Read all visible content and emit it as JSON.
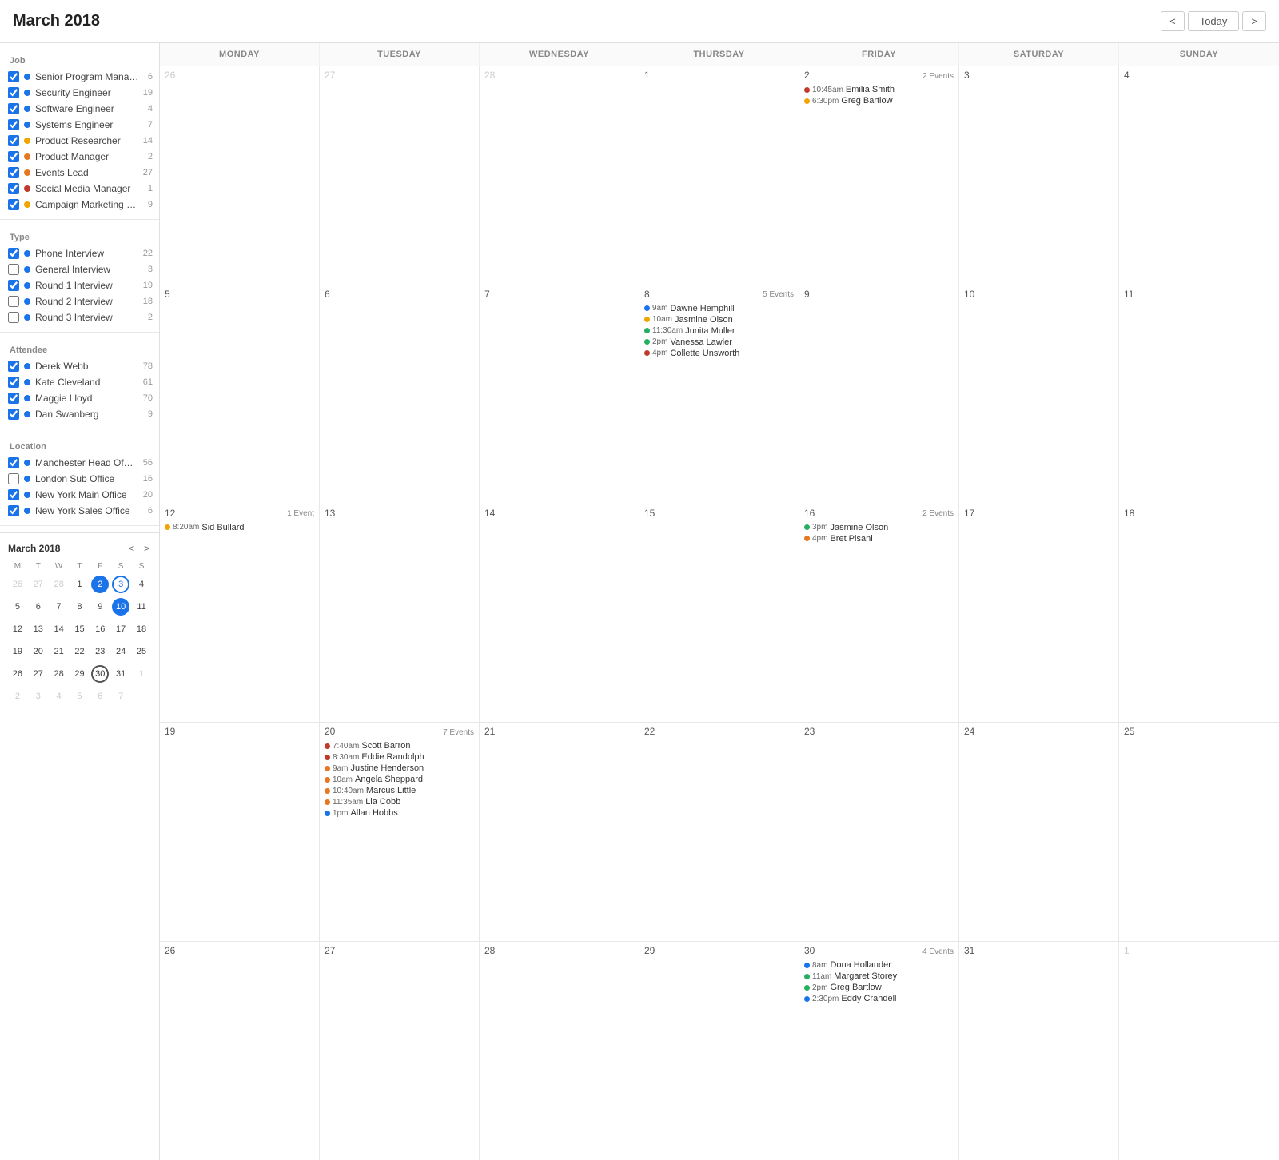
{
  "header": {
    "title": "March 2018",
    "nav_prev": "<",
    "nav_today": "Today",
    "nav_next": ">"
  },
  "sidebar": {
    "sections": [
      {
        "id": "job",
        "title": "Job",
        "items": [
          {
            "label": "Senior Program Manage...",
            "count": 6,
            "checked": true,
            "color": "#1a73e8"
          },
          {
            "label": "Security Engineer",
            "count": 19,
            "checked": true,
            "color": "#1a73e8"
          },
          {
            "label": "Software Engineer",
            "count": 4,
            "checked": true,
            "color": "#1a73e8"
          },
          {
            "label": "Systems Engineer",
            "count": 7,
            "checked": true,
            "color": "#1a73e8"
          },
          {
            "label": "Product Researcher",
            "count": 14,
            "checked": true,
            "color": "#f0a500"
          },
          {
            "label": "Product Manager",
            "count": 2,
            "checked": true,
            "color": "#e87722"
          },
          {
            "label": "Events Lead",
            "count": 27,
            "checked": true,
            "color": "#e87722"
          },
          {
            "label": "Social Media Manager",
            "count": 1,
            "checked": true,
            "color": "#c0392b"
          },
          {
            "label": "Campaign Marketing Ma...",
            "count": 9,
            "checked": true,
            "color": "#f0a500"
          }
        ]
      },
      {
        "id": "type",
        "title": "Type",
        "items": [
          {
            "label": "Phone Interview",
            "count": 22,
            "checked": true,
            "color": "#1a73e8"
          },
          {
            "label": "General Interview",
            "count": 3,
            "checked": false,
            "color": "#1a73e8"
          },
          {
            "label": "Round 1 Interview",
            "count": 19,
            "checked": true,
            "color": "#1a73e8"
          },
          {
            "label": "Round 2 Interview",
            "count": 18,
            "checked": false,
            "color": "#1a73e8"
          },
          {
            "label": "Round 3 Interview",
            "count": 2,
            "checked": false,
            "color": "#1a73e8"
          }
        ]
      },
      {
        "id": "attendee",
        "title": "Attendee",
        "items": [
          {
            "label": "Derek Webb",
            "count": 78,
            "checked": true,
            "color": "#1a73e8"
          },
          {
            "label": "Kate Cleveland",
            "count": 61,
            "checked": true,
            "color": "#1a73e8"
          },
          {
            "label": "Maggie Lloyd",
            "count": 70,
            "checked": true,
            "color": "#1a73e8"
          },
          {
            "label": "Dan Swanberg",
            "count": 9,
            "checked": true,
            "color": "#1a73e8"
          }
        ]
      },
      {
        "id": "location",
        "title": "Location",
        "items": [
          {
            "label": "Manchester Head Office",
            "count": 56,
            "checked": true,
            "color": "#1a73e8"
          },
          {
            "label": "London Sub Office",
            "count": 16,
            "checked": false,
            "color": "#1a73e8"
          },
          {
            "label": "New York Main Office",
            "count": 20,
            "checked": true,
            "color": "#1a73e8"
          },
          {
            "label": "New York Sales Office",
            "count": 6,
            "checked": true,
            "color": "#1a73e8"
          }
        ]
      }
    ]
  },
  "mini_calendar": {
    "title": "March 2018",
    "days_of_week": [
      "M",
      "T",
      "W",
      "T",
      "F",
      "S",
      "S"
    ],
    "weeks": [
      [
        {
          "day": 26,
          "other": true
        },
        {
          "day": 27,
          "other": true
        },
        {
          "day": 28,
          "other": true
        },
        {
          "day": 1
        },
        {
          "day": 2,
          "highlight": "blue"
        },
        {
          "day": 3,
          "highlight": "ring"
        },
        {
          "day": 4
        }
      ],
      [
        {
          "day": 5
        },
        {
          "day": 6
        },
        {
          "day": 7
        },
        {
          "day": 8
        },
        {
          "day": 9
        },
        {
          "day": 10,
          "highlight": "filled-blue"
        },
        {
          "day": 11
        }
      ],
      [
        {
          "day": 12
        },
        {
          "day": 13
        },
        {
          "day": 14
        },
        {
          "day": 15
        },
        {
          "day": 16
        },
        {
          "day": 17
        },
        {
          "day": 18
        }
      ],
      [
        {
          "day": 19
        },
        {
          "day": 20
        },
        {
          "day": 21
        },
        {
          "day": 22
        },
        {
          "day": 23
        },
        {
          "day": 24
        },
        {
          "day": 25
        }
      ],
      [
        {
          "day": 26
        },
        {
          "day": 27
        },
        {
          "day": 28
        },
        {
          "day": 29
        },
        {
          "day": 30,
          "highlight": "gray-ring"
        },
        {
          "day": 31
        },
        {
          "day": 1,
          "other": true
        }
      ],
      [
        {
          "day": 2,
          "other": true
        },
        {
          "day": 3,
          "other": true
        },
        {
          "day": 4,
          "other": true
        },
        {
          "day": 5,
          "other": true
        },
        {
          "day": 6,
          "other": true
        },
        {
          "day": 7,
          "other": true
        }
      ]
    ]
  },
  "calendar": {
    "col_headers": [
      "MONDAY",
      "TUESDAY",
      "WEDNESDAY",
      "THURSDAY",
      "FRIDAY",
      "SATURDAY",
      "SUNDAY"
    ],
    "weeks": [
      {
        "days": [
          {
            "num": 26,
            "other": true,
            "events": []
          },
          {
            "num": 27,
            "other": true,
            "events": []
          },
          {
            "num": 28,
            "other": true,
            "events": []
          },
          {
            "num": 1,
            "events": [],
            "events_count": ""
          },
          {
            "num": 2,
            "events_count": "2 Events",
            "events": [
              {
                "time": "10:45am",
                "name": "Emilia Smith",
                "color": "#c0392b"
              },
              {
                "time": "6:30pm",
                "name": "Greg Bartlow",
                "color": "#f0a500"
              }
            ]
          },
          {
            "num": 3,
            "events": []
          },
          {
            "num": 4,
            "events": []
          }
        ]
      },
      {
        "days": [
          {
            "num": 5,
            "events": []
          },
          {
            "num": 6,
            "events": []
          },
          {
            "num": 7,
            "events": []
          },
          {
            "num": 8,
            "events_count": "5 Events",
            "events": [
              {
                "time": "9am",
                "name": "Dawne Hemphill",
                "color": "#1a73e8"
              },
              {
                "time": "10am",
                "name": "Jasmine Olson",
                "color": "#f0a500"
              },
              {
                "time": "11:30am",
                "name": "Junita Muller",
                "color": "#27ae60"
              },
              {
                "time": "2pm",
                "name": "Vanessa Lawler",
                "color": "#27ae60"
              },
              {
                "time": "4pm",
                "name": "Collette Unsworth",
                "color": "#c0392b"
              }
            ]
          },
          {
            "num": 9,
            "events": []
          },
          {
            "num": 10,
            "events": []
          },
          {
            "num": 11,
            "events": []
          }
        ]
      },
      {
        "days": [
          {
            "num": 12,
            "events_count": "1 Event",
            "events": [
              {
                "time": "8:20am",
                "name": "Sid Bullard",
                "color": "#f0a500"
              }
            ]
          },
          {
            "num": 13,
            "events": []
          },
          {
            "num": 14,
            "events": []
          },
          {
            "num": 15,
            "events": []
          },
          {
            "num": 16,
            "events_count": "2 Events",
            "events": [
              {
                "time": "3pm",
                "name": "Jasmine Olson",
                "color": "#27ae60"
              },
              {
                "time": "4pm",
                "name": "Bret Pisani",
                "color": "#e87722"
              }
            ]
          },
          {
            "num": 17,
            "events": []
          },
          {
            "num": 18,
            "events": []
          }
        ]
      },
      {
        "days": [
          {
            "num": 19,
            "events": []
          },
          {
            "num": 20,
            "events_count": "7 Events",
            "events": [
              {
                "time": "7:40am",
                "name": "Scott Barron",
                "color": "#c0392b"
              },
              {
                "time": "8:30am",
                "name": "Eddie Randolph",
                "color": "#c0392b"
              },
              {
                "time": "9am",
                "name": "Justine Henderson",
                "color": "#e87722"
              },
              {
                "time": "10am",
                "name": "Angela Sheppard",
                "color": "#e87722"
              },
              {
                "time": "10:40am",
                "name": "Marcus Little",
                "color": "#e87722"
              },
              {
                "time": "11:35am",
                "name": "Lia Cobb",
                "color": "#e87722"
              },
              {
                "time": "1pm",
                "name": "Allan Hobbs",
                "color": "#1a73e8"
              }
            ]
          },
          {
            "num": 21,
            "events": []
          },
          {
            "num": 22,
            "events": []
          },
          {
            "num": 23,
            "events": []
          },
          {
            "num": 24,
            "events": []
          },
          {
            "num": 25,
            "events": []
          }
        ]
      },
      {
        "days": [
          {
            "num": 26,
            "events": []
          },
          {
            "num": 27,
            "events": []
          },
          {
            "num": 28,
            "events": []
          },
          {
            "num": 29,
            "events": []
          },
          {
            "num": 30,
            "events_count": "4 Events",
            "events": [
              {
                "time": "8am",
                "name": "Dona Hollander",
                "color": "#1a73e8"
              },
              {
                "time": "11am",
                "name": "Margaret Storey",
                "color": "#27ae60"
              },
              {
                "time": "2pm",
                "name": "Greg Bartlow",
                "color": "#27ae60"
              },
              {
                "time": "2:30pm",
                "name": "Eddy Crandell",
                "color": "#1a73e8"
              }
            ]
          },
          {
            "num": 31,
            "events": []
          },
          {
            "num": 1,
            "other": true,
            "events": []
          }
        ]
      }
    ]
  }
}
